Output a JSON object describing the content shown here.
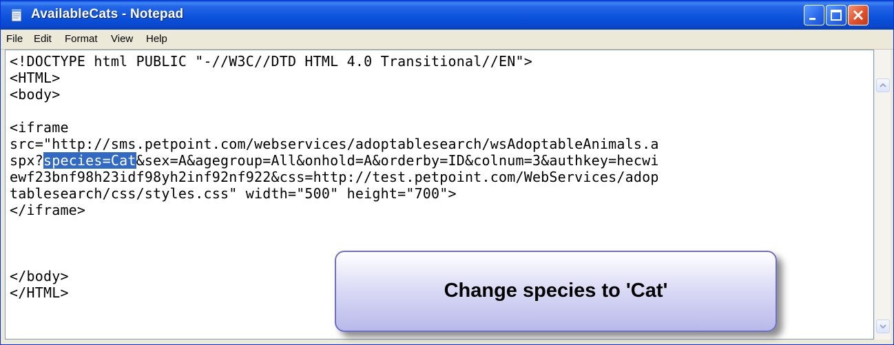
{
  "window": {
    "title": "AvailableCats - Notepad",
    "icon": "notepad-icon"
  },
  "menu": {
    "file": "File",
    "edit": "Edit",
    "format": "Format",
    "view": "View",
    "help": "Help"
  },
  "editor": {
    "line1": "<!DOCTYPE html PUBLIC \"-//W3C//DTD HTML 4.0 Transitional//EN\">",
    "line2": "<HTML>",
    "line3": "<body>",
    "line4": "",
    "line5": "<iframe",
    "line6": "src=\"http://sms.petpoint.com/webservices/adoptablesearch/wsAdoptableAnimals.a",
    "line7_pre": "spx?",
    "line7_selected": "species=Cat",
    "line7_post": "&sex=A&agegroup=All&onhold=A&orderby=ID&colnum=3&authkey=hecwi",
    "line8": "ewf23bnf98h23idf98yh2inf92nf922&css=http://test.petpoint.com/WebServices/adop",
    "line9": "tablesearch/css/styles.css\" width=\"500\" height=\"700\">",
    "line10": "</iframe>",
    "line11": "",
    "line12": "",
    "line13": "",
    "line14": "</body>",
    "line15": "</HTML>"
  },
  "callout": {
    "text": "Change species to 'Cat'"
  },
  "colors": {
    "titlebar": "#0a4fd6",
    "selection": "#316ac5",
    "close_button": "#e0512b"
  }
}
